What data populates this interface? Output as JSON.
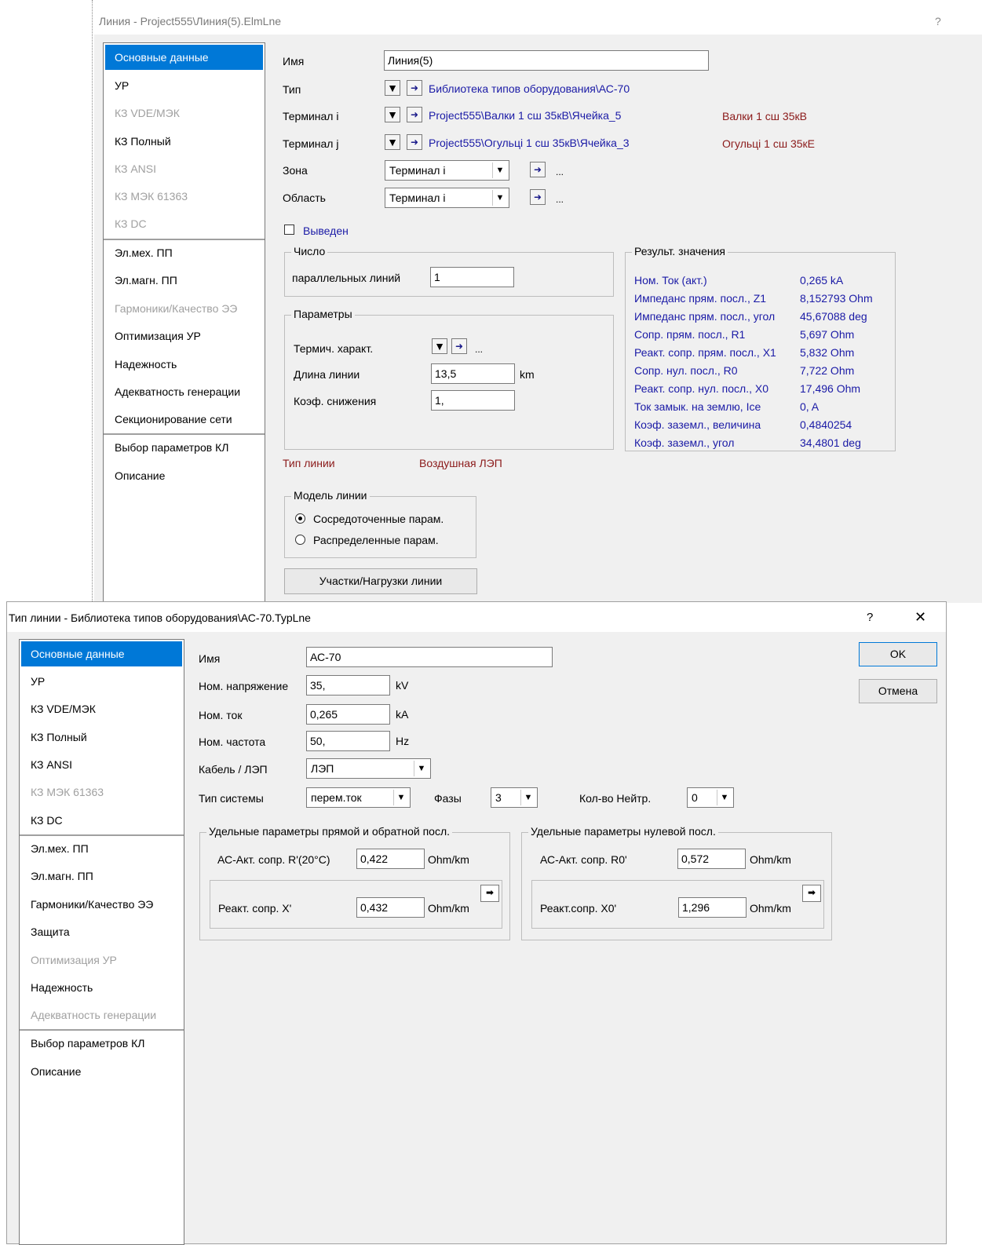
{
  "line_dialog": {
    "title": "Линия - Project555\\Линия(5).ElmLne",
    "help_label": "?",
    "nav": [
      {
        "label": "Основные данные",
        "state": "active"
      },
      {
        "label": "УР",
        "state": "normal"
      },
      {
        "label": "КЗ VDE/МЭК",
        "state": "disabled"
      },
      {
        "label": "КЗ Полный",
        "state": "normal"
      },
      {
        "label": "КЗ ANSI",
        "state": "disabled"
      },
      {
        "label": "КЗ МЭК 61363",
        "state": "disabled"
      },
      {
        "label": "КЗ DC",
        "state": "disabled"
      },
      {
        "label": "Эл.мех. ПП",
        "state": "normal"
      },
      {
        "label": "Эл.магн. ПП",
        "state": "normal"
      },
      {
        "label": "Гармоники/Качество ЭЭ",
        "state": "disabled"
      },
      {
        "label": "Оптимизация УР",
        "state": "normal"
      },
      {
        "label": "Надежность",
        "state": "normal"
      },
      {
        "label": "Адекватность генерации",
        "state": "normal"
      },
      {
        "label": "Секционирование сети",
        "state": "normal"
      },
      {
        "label": "Выбор параметров КЛ",
        "state": "normal"
      },
      {
        "label": "Описание",
        "state": "normal"
      }
    ],
    "name_label": "Имя",
    "name_value": "Линия(5)",
    "type_label": "Тип",
    "type_link": "Библиотека типов оборудования\\АС-70",
    "terminal_i_label": "Терминал i",
    "terminal_i_link": "Project555\\Валки 1 сш 35кВ\\Ячейка_5",
    "terminal_i_bus": "Валки 1 сш 35кВ",
    "terminal_j_label": "Терминал j",
    "terminal_j_link": "Project555\\Огульцi 1 сш 35кВ\\Ячейка_3",
    "terminal_j_bus": "Огульцi 1 сш 35кЕ",
    "zone_label": "Зона",
    "zone_value": "Терминал i",
    "area_label": "Область",
    "area_value": "Терминал i",
    "ellipsis": "...",
    "out_of_service_label": "Выведен",
    "out_of_service_checked": false,
    "number_group_title": "Число",
    "parallel_lines_label": "параллельных линий",
    "parallel_lines_value": "1",
    "params_group_title": "Параметры",
    "thermal_label": "Термич. характ.",
    "length_label": "Длина линии",
    "length_value": "13,5",
    "length_unit": "km",
    "derating_label": "Коэф. снижения",
    "derating_value": "1,",
    "line_type_label": "Тип линии",
    "line_type_value": "Воздушная ЛЭП",
    "model_group_title": "Модель линии",
    "model_lumped": "Сосредоточенные парам.",
    "model_distributed": "Распределенные парам.",
    "model_selected": "lumped",
    "sections_button": "Участки/Нагрузки линии",
    "results_group_title": "Результ. значения",
    "results": [
      {
        "label": "Ном. Ток (акт.)",
        "value": "0,265 kA"
      },
      {
        "label": "Импеданс прям. посл., Z1",
        "value": "8,152793 Ohm"
      },
      {
        "label": "Импеданс прям. посл., угол",
        "value": "45,67088 deg"
      },
      {
        "label": "Сопр. прям. посл., R1",
        "value": "5,697 Ohm"
      },
      {
        "label": "Реакт. сопр. прям. посл., X1",
        "value": "5,832 Ohm"
      },
      {
        "label": "Сопр. нул. посл., R0",
        "value": "7,722 Ohm"
      },
      {
        "label": "Реакт. сопр. нул. посл., X0",
        "value": "17,496 Ohm"
      },
      {
        "label": "Ток замык. на землю, Ice",
        "value": "0, A"
      },
      {
        "label": "Коэф. заземл., величина",
        "value": "0,4840254"
      },
      {
        "label": "Коэф. заземл., угол",
        "value": "34,4801 deg"
      }
    ]
  },
  "type_dialog": {
    "title": "Тип линии - Библиотека типов оборудования\\АС-70.TypLne",
    "help_label": "?",
    "close_label": "✕",
    "ok_label": "OK",
    "cancel_label": "Отмена",
    "nav": [
      {
        "label": "Основные данные",
        "state": "active"
      },
      {
        "label": "УР",
        "state": "normal"
      },
      {
        "label": "КЗ VDE/МЭК",
        "state": "normal"
      },
      {
        "label": "КЗ Полный",
        "state": "normal"
      },
      {
        "label": "КЗ ANSI",
        "state": "normal"
      },
      {
        "label": "КЗ МЭК 61363",
        "state": "disabled"
      },
      {
        "label": "КЗ DC",
        "state": "normal"
      },
      {
        "label": "Эл.мех. ПП",
        "state": "normal"
      },
      {
        "label": "Эл.магн. ПП",
        "state": "normal"
      },
      {
        "label": "Гармоники/Качество ЭЭ",
        "state": "normal"
      },
      {
        "label": "Защита",
        "state": "normal"
      },
      {
        "label": "Оптимизация УР",
        "state": "disabled"
      },
      {
        "label": "Надежность",
        "state": "normal"
      },
      {
        "label": "Адекватность генерации",
        "state": "disabled"
      },
      {
        "label": "Выбор параметров КЛ",
        "state": "normal"
      },
      {
        "label": "Описание",
        "state": "normal"
      }
    ],
    "name_label": "Имя",
    "name_value": "АС-70",
    "voltage_label": "Ном. напряжение",
    "voltage_value": "35,",
    "voltage_unit": "kV",
    "current_label": "Ном. ток",
    "current_value": "0,265",
    "current_unit": "kA",
    "freq_label": "Ном. частота",
    "freq_value": "50,",
    "freq_unit": "Hz",
    "cable_label": "Кабель / ЛЭП",
    "cable_value": "ЛЭП",
    "system_label": "Тип системы",
    "system_value": "перем.ток",
    "phases_label": "Фазы",
    "phases_value": "3",
    "neutral_label": "Кол-во Нейтр.",
    "neutral_value": "0",
    "pos_group_title": "Удельные параметры прямой и обратной посл.",
    "r_label": "АС-Акт. сопр. R'(20°C)",
    "r_value": "0,422",
    "x_label": "Реакт. сопр. X'",
    "x_value": "0,432",
    "zero_group_title": "Удельные параметры нулевой посл.",
    "r0_label": "АС-Акт. сопр. R0'",
    "r0_value": "0,572",
    "x0_label": "Реакт.сопр. X0'",
    "x0_value": "1,296",
    "unit_ohm_km": "Ohm/km"
  }
}
